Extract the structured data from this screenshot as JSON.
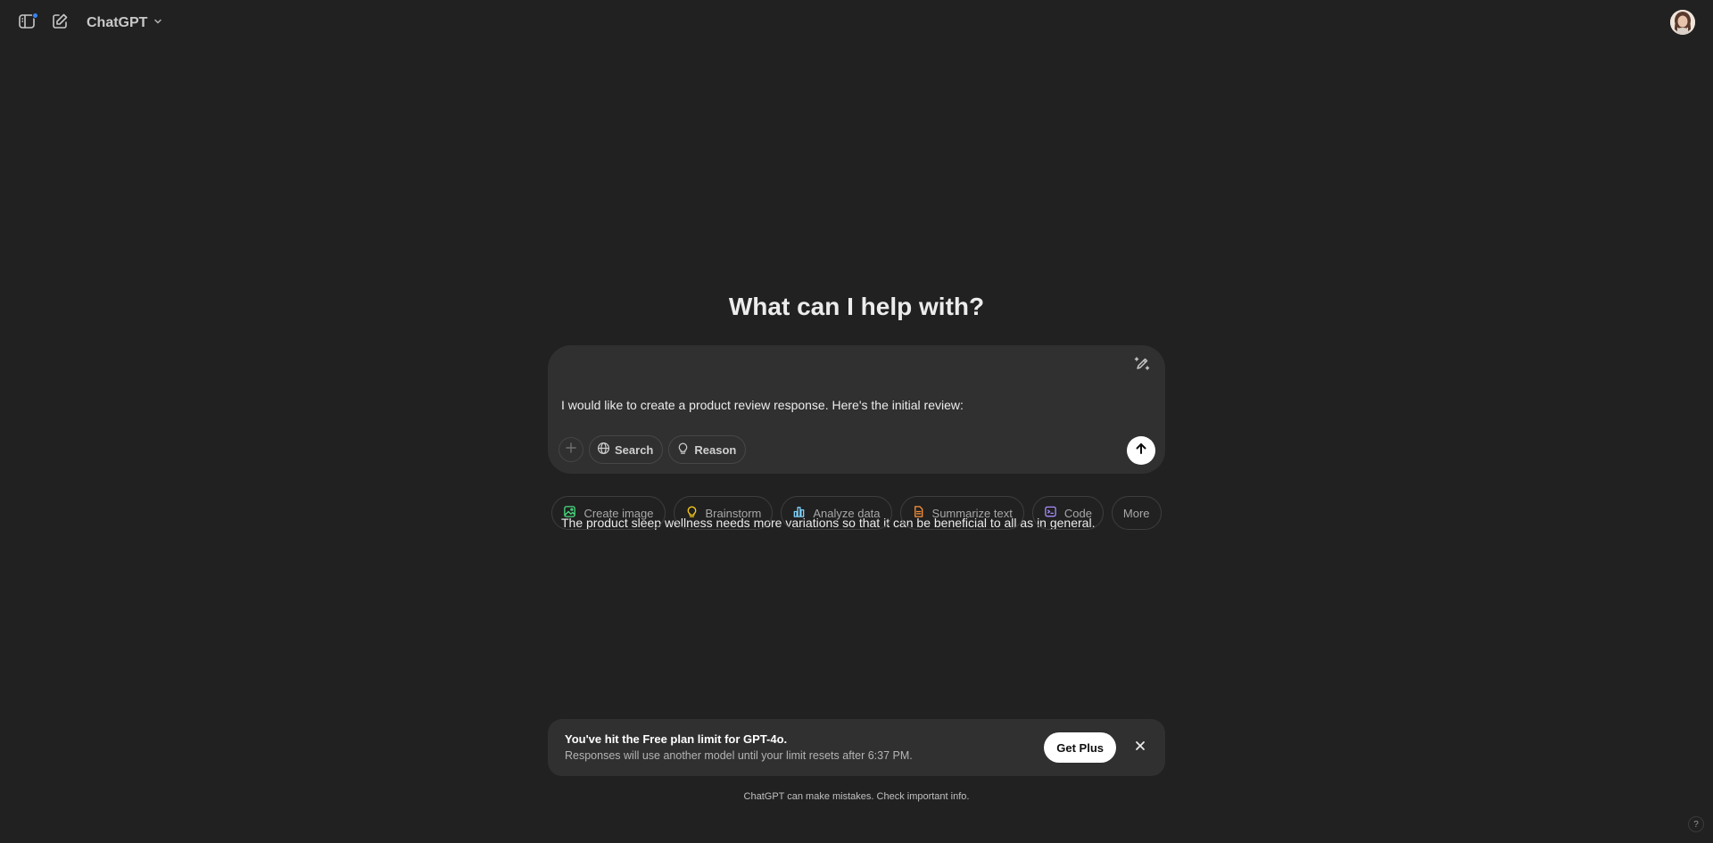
{
  "header": {
    "model_name": "ChatGPT",
    "icons": [
      "sidebar-icon",
      "new-chat-icon",
      "chevron-down-icon"
    ]
  },
  "main": {
    "headline": "What can I help with?",
    "composer": {
      "line1": "I would like to create a product review response. Here's the initial review:",
      "line2": "The product sleep wellness needs more variations so that it can be beneficial to all as in general.",
      "tools": {
        "search_label": "Search",
        "reason_label": "Reason"
      }
    },
    "suggestions": [
      {
        "label": "Create image",
        "icon": "image-icon",
        "color": "#4ade80"
      },
      {
        "label": "Brainstorm",
        "icon": "lightbulb-icon",
        "color": "#facc15"
      },
      {
        "label": "Analyze data",
        "icon": "bar-chart-icon",
        "color": "#7dd3fc"
      },
      {
        "label": "Summarize text",
        "icon": "document-icon",
        "color": "#fb923c"
      },
      {
        "label": "Code",
        "icon": "code-icon",
        "color": "#a78bfa"
      },
      {
        "label": "More",
        "icon": "",
        "color": ""
      }
    ]
  },
  "limit_banner": {
    "title": "You've hit the Free plan limit for GPT-4o.",
    "subtitle": "Responses will use another model until your limit resets after 6:37 PM.",
    "cta_label": "Get Plus"
  },
  "footer": {
    "disclaimer": "ChatGPT can make mistakes. Check important info.",
    "help_label": "?"
  },
  "colors": {
    "background": "#212121",
    "surface": "#303030",
    "accent_dot": "#3b82f6"
  }
}
